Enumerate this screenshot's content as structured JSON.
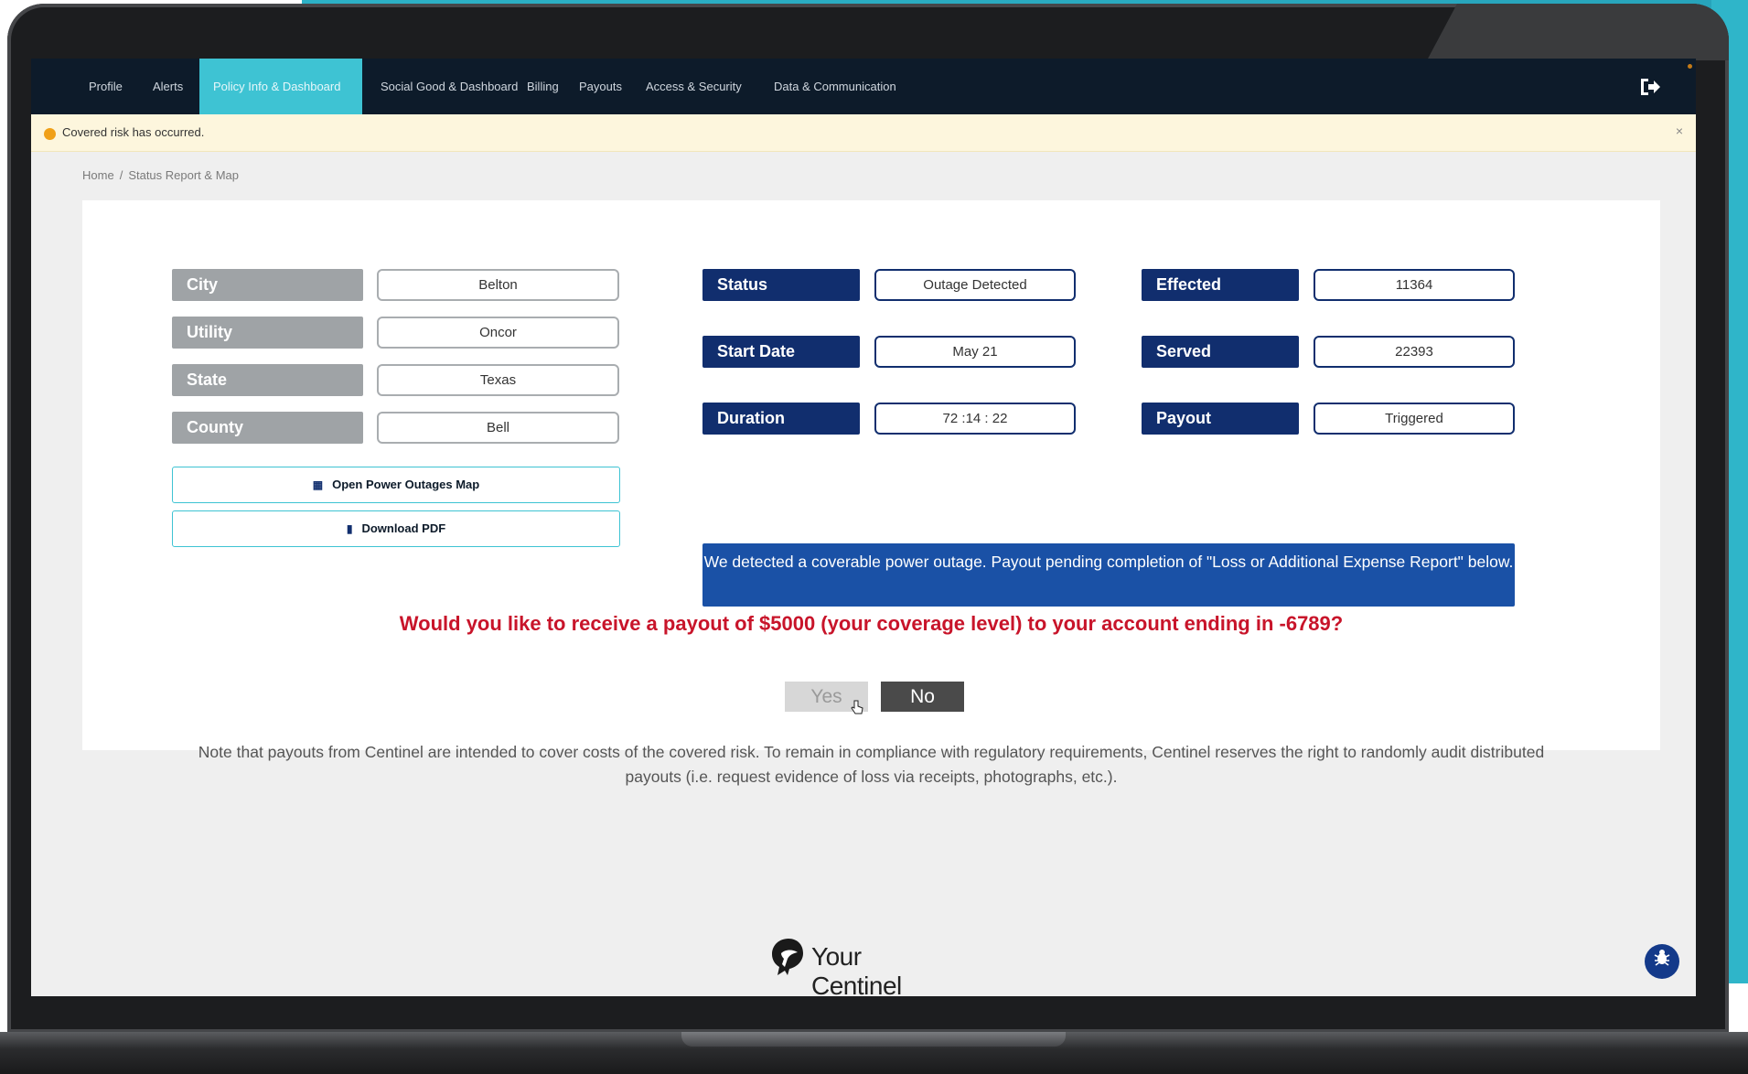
{
  "nav": {
    "items": [
      {
        "label": "Profile"
      },
      {
        "label": "Alerts"
      },
      {
        "label": "Policy Info & Dashboard",
        "active": true
      },
      {
        "label": "Social Good & Dashboard"
      },
      {
        "label": "Billing"
      },
      {
        "label": "Payouts"
      },
      {
        "label": "Access & Security"
      },
      {
        "label": "Data & Communication"
      }
    ],
    "logout_icon": "logout-icon",
    "active_color": "#3ec3d3"
  },
  "alert": {
    "text": "Covered risk has occurred.",
    "close": "×",
    "color": "#f0a018"
  },
  "breadcrumb": {
    "home": "Home",
    "separator": "/",
    "current": "Status Report & Map"
  },
  "location": {
    "city_label": "City",
    "city_value": "Belton",
    "utility_label": "Utility",
    "utility_value": "Oncor",
    "state_label": "State",
    "state_value": "Texas",
    "county_label": "County",
    "county_value": "Bell"
  },
  "status": {
    "status_label": "Status",
    "status_value": "Outage Detected",
    "start_label": "Start Date",
    "start_value": "May 21",
    "duration_label": "Duration",
    "duration_value": "72 :14 : 22",
    "effected_label": "Effected",
    "effected_value": "11364",
    "served_label": "Served",
    "served_value": "22393",
    "payout_label": "Payout",
    "payout_value": "Triggered"
  },
  "actions": {
    "map_button": "Open Power Outages Map",
    "pdf_button": "Download PDF"
  },
  "notice": "We detected a coverable power outage. Payout pending completion of \"Loss or Additional Expense Report\" below.",
  "question": "Would you like to receive a payout of $5000 (your coverage level) to your account ending in -6789?",
  "buttons": {
    "yes": "Yes",
    "no": "No"
  },
  "note": "Note that payouts from Centinel are intended to cover costs of the covered risk. To remain in compliance with regulatory requirements, Centinel reserves the right to randomly audit distributed payouts (i.e. request evidence of loss via receipts, photographs, etc.).",
  "footer": {
    "brand": "Your Centinel"
  },
  "colors": {
    "navy": "#112e6e",
    "alert_red": "#c8142a",
    "notice_blue": "#1a51a6"
  }
}
